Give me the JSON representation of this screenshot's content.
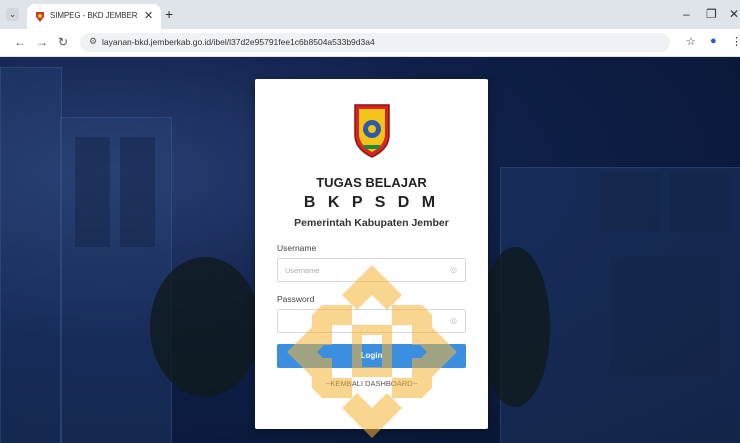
{
  "browser": {
    "tab": {
      "title": "SIMPEG - BKD JEMBER"
    },
    "url": "layanan-bkd.jemberkab.go.id/ibel/l37d2e95791fee1c6b8504a533b9d3a4"
  },
  "login": {
    "title_line1": "TUGAS BELAJAR",
    "title_line2": "B K P S D M",
    "title_line3": "Pemerintah Kabupaten Jember",
    "username_label": "Username",
    "username_placeholder": "Username",
    "password_label": "Password",
    "login_button": "Login",
    "back_link": "--KEMBALI DASHBOARD--"
  },
  "colors": {
    "login_button": "#3b8fe0",
    "watermark": "#f5b335",
    "background": "#0e1f48"
  },
  "icons": {
    "username_field": "user-icon",
    "password_field": "lock-icon"
  }
}
